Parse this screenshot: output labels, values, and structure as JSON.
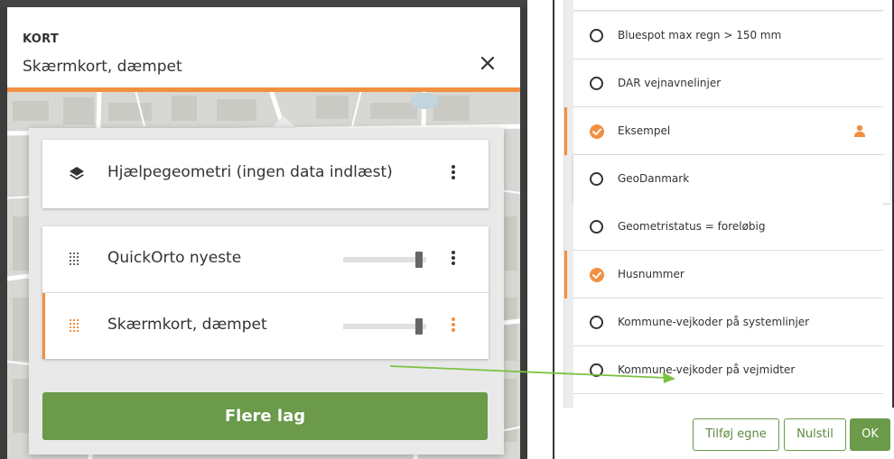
{
  "left_panel": {
    "header": {
      "subtitle": "KORT",
      "title": "Skærmkort, dæmpet"
    },
    "helper_layer": {
      "label": "Hjælpegeometri (ingen data indlæst)",
      "icon": "layers-icon"
    },
    "layers": [
      {
        "label": "QuickOrto nyeste",
        "opacity": 0.95,
        "active": false
      },
      {
        "label": "Skærmkort, dæmpet",
        "opacity": 0.95,
        "active": true
      }
    ],
    "more_button": "Flere lag"
  },
  "right_panel": {
    "items": [
      {
        "label": "Bluespot max regn > 150 mm",
        "checked": false
      },
      {
        "label": "DAR vejnavnelinjer",
        "checked": false
      },
      {
        "label": "Eksempel",
        "checked": true,
        "user_icon": true
      },
      {
        "label": "GeoDanmark",
        "checked": false
      },
      {
        "label": "Geometristatus = foreløbig",
        "checked": false
      },
      {
        "label": "Husnummer",
        "checked": true
      },
      {
        "label": "Kommune-vejkoder på systemlinjer",
        "checked": false
      },
      {
        "label": "Kommune-vejkoder på vejmidter",
        "checked": false
      }
    ],
    "buttons": {
      "add_own": "Tilføj egne",
      "reset": "Nulstil",
      "ok": "OK"
    }
  },
  "colors": {
    "accent": "#f29042",
    "primary_green": "#6a9a4a",
    "annotation_arrow": "#7cc242"
  }
}
